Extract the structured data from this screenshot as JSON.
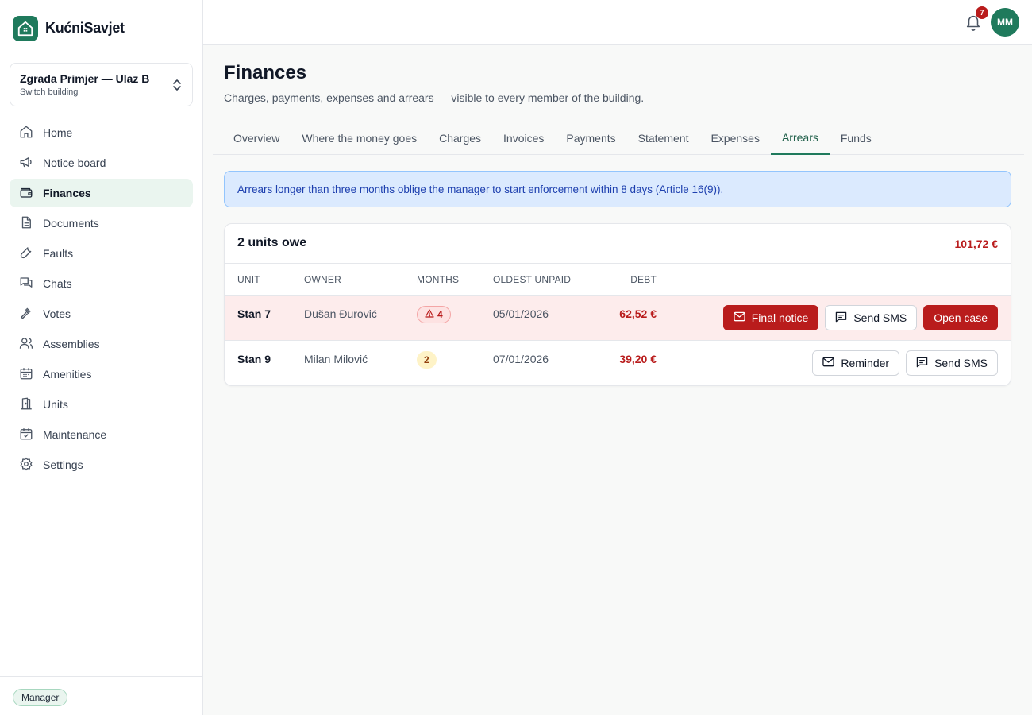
{
  "brand": {
    "name": "KućniSavjet"
  },
  "building": {
    "name": "Zgrada Primjer — Ulaz B",
    "sub": "Switch building"
  },
  "nav": [
    {
      "label": "Home",
      "icon": "home-icon"
    },
    {
      "label": "Notice board",
      "icon": "megaphone-icon"
    },
    {
      "label": "Finances",
      "icon": "wallet-icon",
      "active": true
    },
    {
      "label": "Documents",
      "icon": "document-icon"
    },
    {
      "label": "Faults",
      "icon": "wrench-icon"
    },
    {
      "label": "Chats",
      "icon": "chat-icon"
    },
    {
      "label": "Votes",
      "icon": "gavel-icon"
    },
    {
      "label": "Assemblies",
      "icon": "users-icon"
    },
    {
      "label": "Amenities",
      "icon": "calendar-icon"
    },
    {
      "label": "Units",
      "icon": "door-icon"
    },
    {
      "label": "Maintenance",
      "icon": "calendar-check-icon"
    },
    {
      "label": "Settings",
      "icon": "gear-icon"
    }
  ],
  "footer": {
    "role": "Manager"
  },
  "topbar": {
    "notification_count": "7",
    "avatar_initials": "MM"
  },
  "page": {
    "title": "Finances",
    "subtitle": "Charges, payments, expenses and arrears — visible to every member of the building."
  },
  "tabs": [
    {
      "label": "Overview"
    },
    {
      "label": "Where the money goes"
    },
    {
      "label": "Charges"
    },
    {
      "label": "Invoices"
    },
    {
      "label": "Payments"
    },
    {
      "label": "Statement"
    },
    {
      "label": "Expenses"
    },
    {
      "label": "Arrears",
      "active": true
    },
    {
      "label": "Funds"
    }
  ],
  "alert": {
    "text": "Arrears longer than three months oblige the manager to start enforcement within 8 days (Article 16(9))."
  },
  "arrears": {
    "title": "2 units owe",
    "total": "101,72 €",
    "columns": {
      "unit": "UNIT",
      "owner": "OWNER",
      "months": "MONTHS",
      "oldest": "OLDEST UNPAID",
      "debt": "DEBT"
    },
    "rows": [
      {
        "unit": "Stan 7",
        "owner": "Dušan Đurović",
        "months": "4",
        "oldest": "05/01/2026",
        "debt": "62,52 €",
        "actions": {
          "notice": "Final notice",
          "sms": "Send SMS",
          "case": "Open case"
        }
      },
      {
        "unit": "Stan 9",
        "owner": "Milan Milović",
        "months": "2",
        "oldest": "07/01/2026",
        "debt": "39,20 €",
        "actions": {
          "reminder": "Reminder",
          "sms": "Send SMS"
        }
      }
    ]
  },
  "colors": {
    "brand": "#1f7a5c",
    "danger": "#b91c1c",
    "info_bg": "#dbeafe",
    "info_text": "#1e40af"
  }
}
